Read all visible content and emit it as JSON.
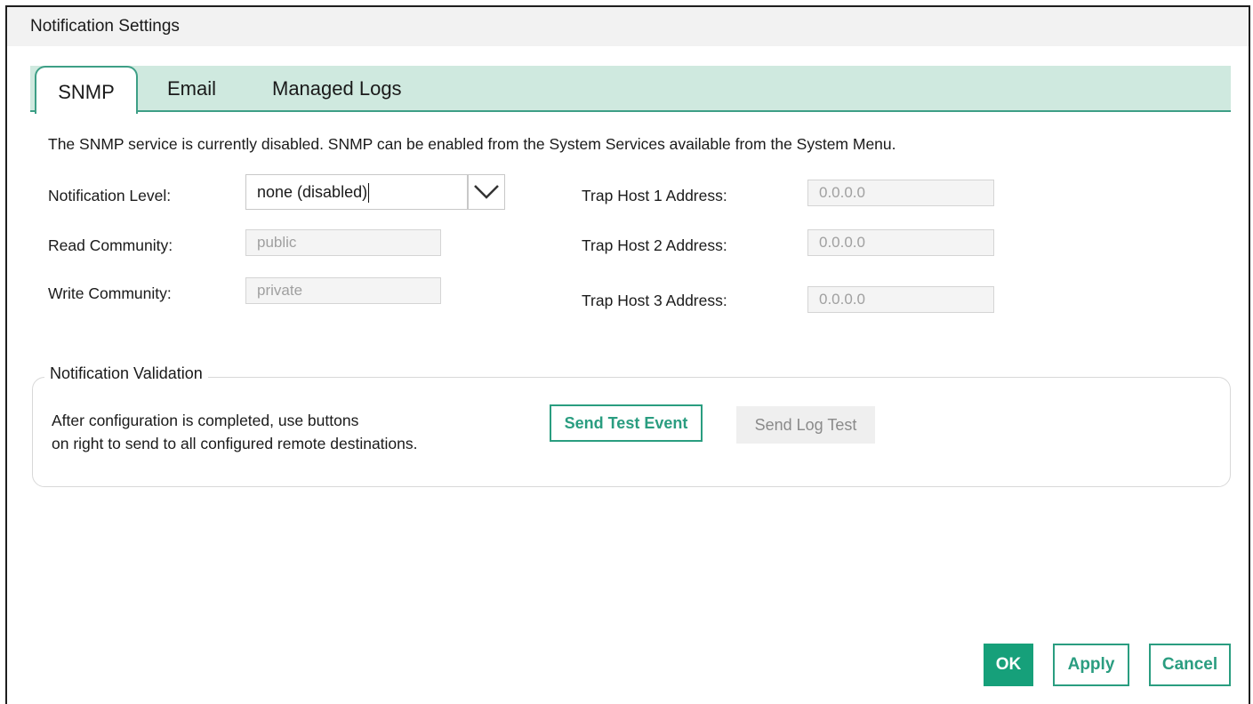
{
  "window": {
    "title": "Notification Settings"
  },
  "tabs": [
    {
      "label": "SNMP",
      "active": true
    },
    {
      "label": "Email",
      "active": false
    },
    {
      "label": "Managed Logs",
      "active": false
    }
  ],
  "snmp": {
    "info": "The SNMP service is currently disabled. SNMP can be enabled from the System Services available from the System Menu.",
    "notification_level": {
      "label": "Notification Level:",
      "value": "none (disabled)"
    },
    "read_community": {
      "label": "Read Community:",
      "value": "public"
    },
    "write_community": {
      "label": "Write Community:",
      "value": "private"
    },
    "trap_host_1": {
      "label": "Trap Host 1 Address:",
      "value": "0.0.0.0"
    },
    "trap_host_2": {
      "label": "Trap Host 2 Address:",
      "value": "0.0.0.0"
    },
    "trap_host_3": {
      "label": "Trap Host 3 Address:",
      "value": "0.0.0.0"
    }
  },
  "validation": {
    "title": "Notification Validation",
    "text_line1": "After configuration is completed, use buttons",
    "text_line2": "on right to send to all configured remote destinations.",
    "send_test_event": "Send Test Event",
    "send_log_test": "Send Log Test"
  },
  "footer": {
    "ok": "OK",
    "apply": "Apply",
    "cancel": "Cancel"
  },
  "colors": {
    "accent": "#16a07a",
    "tabstrip": "#cfe9df"
  }
}
